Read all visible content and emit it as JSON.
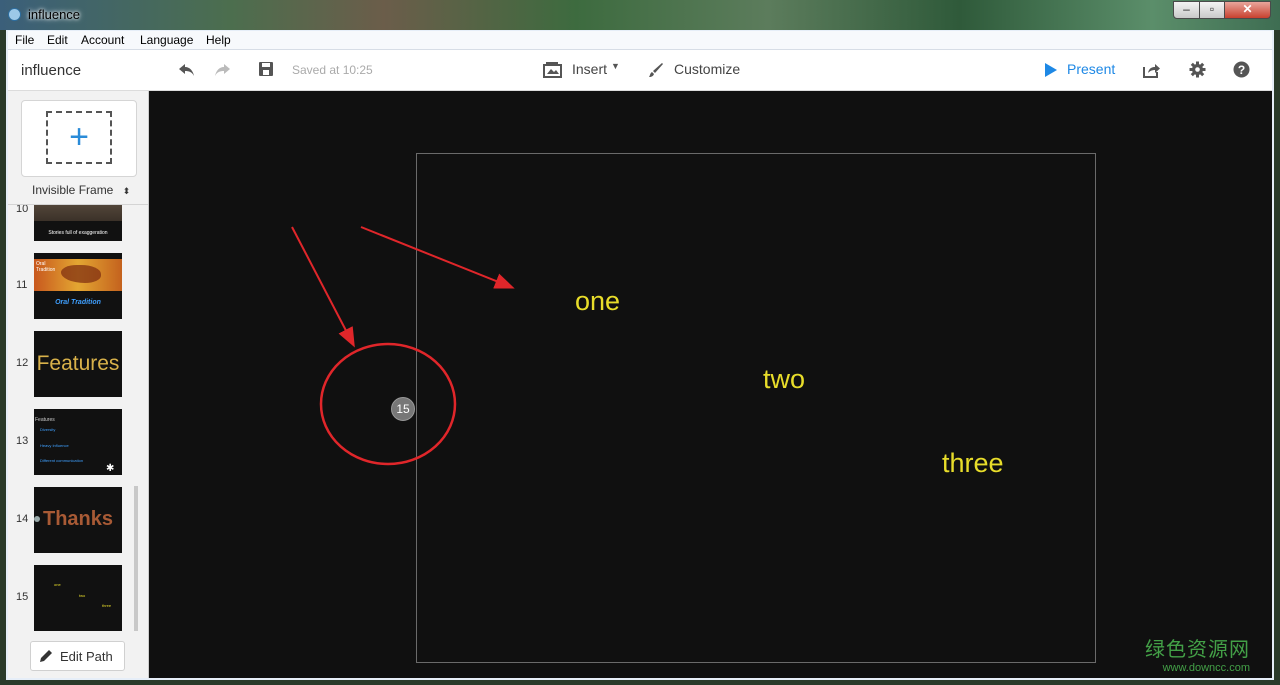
{
  "window": {
    "title": "influence",
    "controls": {
      "minimize": "–",
      "maximize": "▫",
      "close": "✕"
    }
  },
  "menu": [
    "File",
    "Edit",
    "Account",
    "Language",
    "Help"
  ],
  "toolbar": {
    "doc_name": "influence",
    "saved": "Saved at 10:25",
    "insert": "Insert",
    "customize": "Customize",
    "present": "Present",
    "present_color": "#1e88e5"
  },
  "sidebar": {
    "frame_type": "Invisible Frame",
    "edit_path": "Edit Path",
    "slides": [
      {
        "number": "10",
        "caption": "Stories full of exaggeration"
      },
      {
        "number": "11",
        "heading": "Oral Tradition",
        "caption": "Oral Tradition"
      },
      {
        "number": "12",
        "caption": "Features"
      },
      {
        "number": "13",
        "heading": "Features",
        "items": [
          "Diversity",
          "Heavy Influence",
          "Different communication"
        ]
      },
      {
        "number": "14",
        "caption": "Thanks"
      },
      {
        "number": "15",
        "words": [
          "one",
          "two",
          "three"
        ]
      }
    ]
  },
  "canvas": {
    "path_marker": "15",
    "words": [
      "one",
      "two",
      "three"
    ],
    "text_color": "#e8dd2a",
    "annotation_color": "#e0262a"
  },
  "watermark": {
    "cn": "绿色资源网",
    "url": "www.downcc.com"
  }
}
